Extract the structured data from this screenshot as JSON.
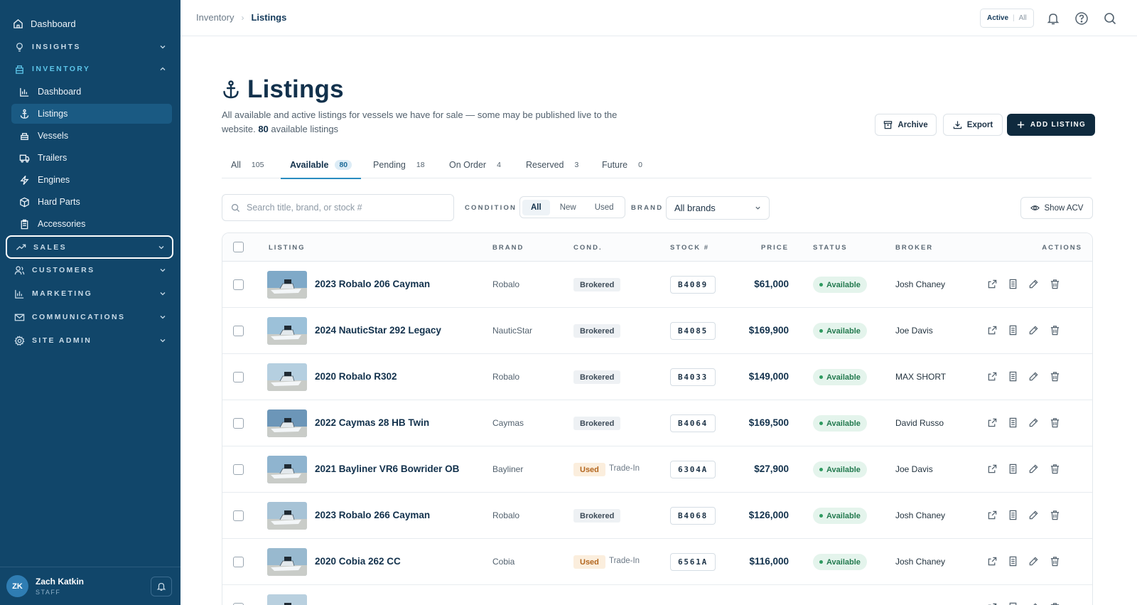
{
  "sidebar": {
    "top": {
      "label": "Dashboard",
      "icon": "home-icon"
    },
    "sections": [
      {
        "label": "INSIGHTS",
        "icon": "lightbulb-icon",
        "expanded": false
      },
      {
        "label": "INVENTORY",
        "icon": "package-icon",
        "expanded": true
      },
      {
        "label": "SALES",
        "icon": "trending-up-icon",
        "expanded": false
      },
      {
        "label": "CUSTOMERS",
        "icon": "users-icon",
        "expanded": false
      },
      {
        "label": "MARKETING",
        "icon": "bar-chart-icon",
        "expanded": false
      },
      {
        "label": "COMMUNICATIONS",
        "icon": "mail-icon",
        "expanded": false
      },
      {
        "label": "SITE ADMIN",
        "icon": "settings-icon",
        "expanded": false
      }
    ],
    "inventory_items": [
      {
        "label": "Dashboard",
        "icon": "chart-icon"
      },
      {
        "label": "Listings",
        "icon": "anchor-icon",
        "active": true
      },
      {
        "label": "Vessels",
        "icon": "boat-icon"
      },
      {
        "label": "Trailers",
        "icon": "truck-icon"
      },
      {
        "label": "Engines",
        "icon": "bolt-icon"
      },
      {
        "label": "Hard Parts",
        "icon": "box-icon"
      },
      {
        "label": "Accessories",
        "icon": "clipboard-icon"
      }
    ],
    "user": {
      "initials": "ZK",
      "name": "Zach Katkin",
      "role": "STAFF"
    }
  },
  "topbar": {
    "breadcrumb": [
      "Inventory",
      "Listings"
    ],
    "toggle": {
      "active": "Active",
      "other": "All"
    }
  },
  "page": {
    "title": "Listings",
    "description_start": "All available and active listings for vessels we have for sale — some may be published live to the website. ",
    "description_count": "80",
    "description_end": " available listings",
    "buttons": {
      "archive": "Archive",
      "export": "Export",
      "add": "ADD LISTING"
    }
  },
  "tabs": [
    {
      "label": "All",
      "count": "105"
    },
    {
      "label": "Available",
      "count": "80",
      "active": true
    },
    {
      "label": "Pending",
      "count": "18"
    },
    {
      "label": "On Order",
      "count": "4"
    },
    {
      "label": "Reserved",
      "count": "3"
    },
    {
      "label": "Future",
      "count": "0"
    }
  ],
  "filters": {
    "search_placeholder": "Search title, brand, or stock #",
    "condition_label": "CONDITION",
    "condition_options": [
      "All",
      "New",
      "Used"
    ],
    "condition_selected": "All",
    "brand_label": "BRAND",
    "brand_value": "All brands",
    "show_acv": "Show ACV"
  },
  "table": {
    "headers": {
      "listing": "LISTING",
      "brand": "BRAND",
      "cond": "COND.",
      "stock": "STOCK #",
      "price": "PRICE",
      "status": "STATUS",
      "broker": "BROKER",
      "actions": "ACTIONS"
    },
    "rows": [
      {
        "name": "2023 Robalo 206 Cayman",
        "brand": "Robalo",
        "condition": "Brokered",
        "trade_in": "",
        "stock": "B4089",
        "price": "$61,000",
        "status": "Available",
        "broker": "Josh Chaney"
      },
      {
        "name": "2024 NauticStar 292 Legacy",
        "brand": "NauticStar",
        "condition": "Brokered",
        "trade_in": "",
        "stock": "B4085",
        "price": "$169,900",
        "status": "Available",
        "broker": "Joe Davis"
      },
      {
        "name": "2020 Robalo R302",
        "brand": "Robalo",
        "condition": "Brokered",
        "trade_in": "",
        "stock": "B4033",
        "price": "$149,000",
        "status": "Available",
        "broker": "MAX SHORT"
      },
      {
        "name": "2022 Caymas 28 HB Twin",
        "brand": "Caymas",
        "condition": "Brokered",
        "trade_in": "",
        "stock": "B4064",
        "price": "$169,500",
        "status": "Available",
        "broker": "David Russo"
      },
      {
        "name": "2021 Bayliner VR6 Bowrider OB",
        "brand": "Bayliner",
        "condition": "Used",
        "trade_in": "Trade-In",
        "stock": "6304A",
        "price": "$27,900",
        "status": "Available",
        "broker": "Joe Davis"
      },
      {
        "name": "2023 Robalo 266 Cayman",
        "brand": "Robalo",
        "condition": "Brokered",
        "trade_in": "",
        "stock": "B4068",
        "price": "$126,000",
        "status": "Available",
        "broker": "Josh Chaney"
      },
      {
        "name": "2020 Cobia 262 CC",
        "brand": "Cobia",
        "condition": "Used",
        "trade_in": "Trade-In",
        "stock": "6561A",
        "price": "$116,000",
        "status": "Available",
        "broker": "Josh Chaney"
      }
    ]
  },
  "colors": {
    "sidebar": "#11466a",
    "accent": "#2a8cc0",
    "primary_button": "#0f2a3e",
    "status_green": "#237a4f"
  }
}
